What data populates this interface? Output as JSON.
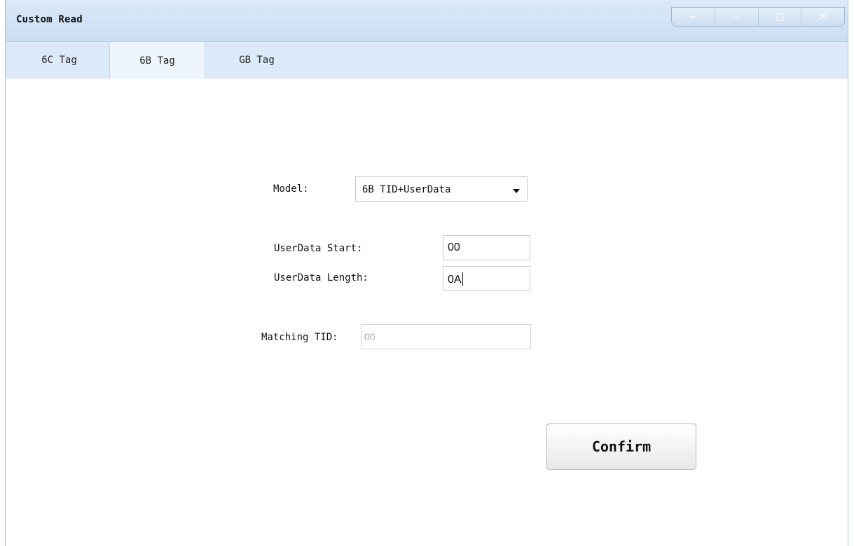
{
  "window": {
    "title": "Custom Read",
    "controls": {
      "dropdown_icon": "⩫",
      "minimize_icon": "–",
      "maximize_icon": "□",
      "close_icon": "✕"
    }
  },
  "tabs": [
    {
      "label": "6C Tag",
      "active": false
    },
    {
      "label": "6B Tag",
      "active": true
    },
    {
      "label": "GB Tag",
      "active": false
    }
  ],
  "form": {
    "model_label": "Model:",
    "model_value": "6B TID+UserData",
    "userdata_start_label": "UserData Start:",
    "userdata_start_value": "00",
    "userdata_length_label": "UserData Length:",
    "userdata_length_value": "0A",
    "matching_tid_label": "Matching TID:",
    "matching_tid_value": "00"
  },
  "actions": {
    "confirm_label": "Confirm"
  },
  "colors": {
    "titlebar": "#c9ddf3",
    "tabbar": "#dce9f8",
    "active_tab": "#eef5fc"
  }
}
